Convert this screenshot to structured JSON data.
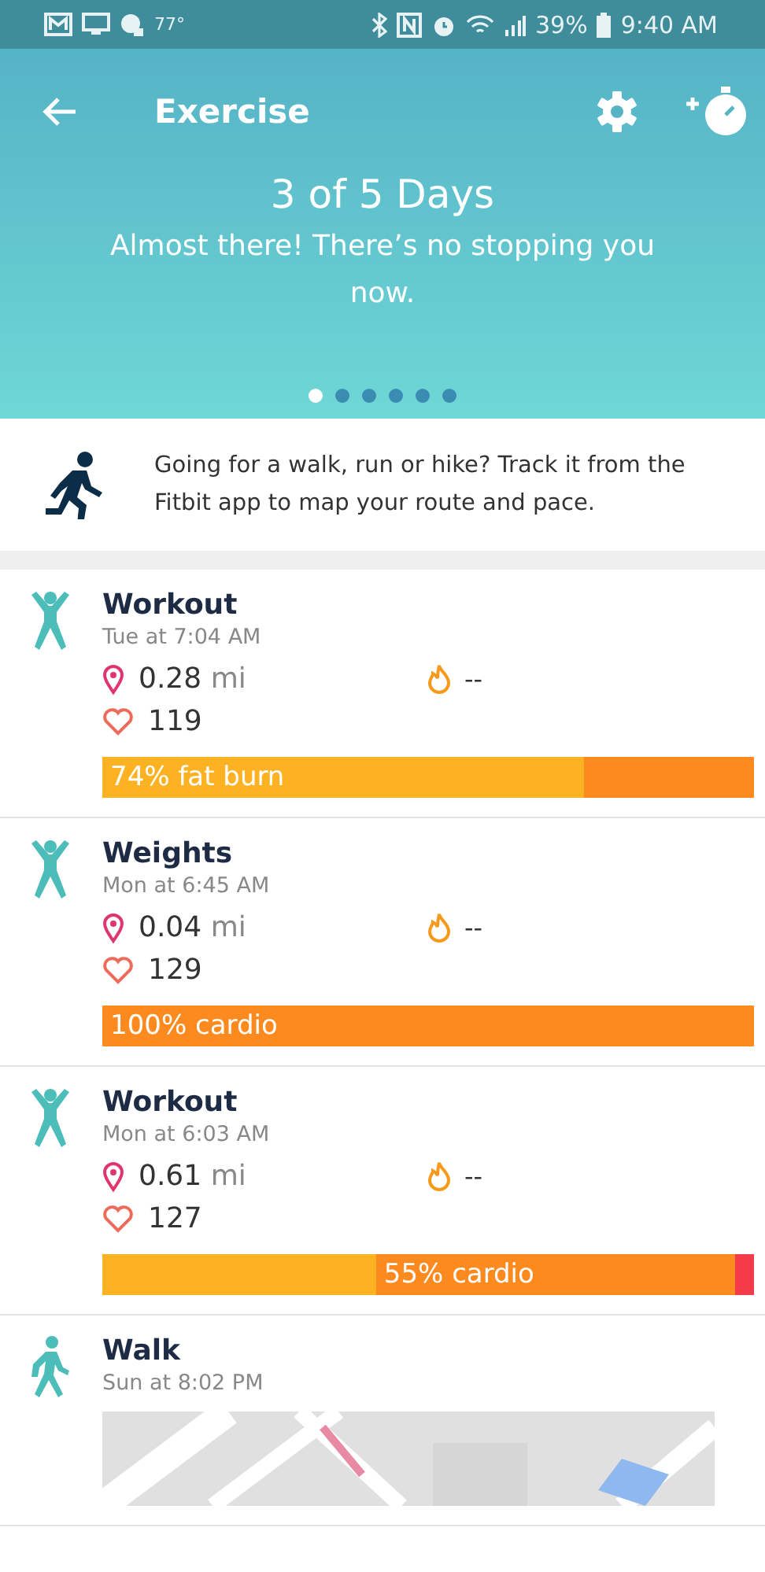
{
  "status_bar": {
    "temperature": "77°",
    "battery": "39%",
    "time": "9:40 AM"
  },
  "toolbar": {
    "title": "Exercise"
  },
  "goal": {
    "title": "3 of 5 Days",
    "message": "Almost there! There’s no stopping you now.",
    "dots": [
      {
        "selected": true
      },
      {
        "selected": false
      },
      {
        "selected": false
      },
      {
        "selected": false
      },
      {
        "selected": false
      },
      {
        "selected": false
      }
    ]
  },
  "tip": {
    "text": "Going for a walk, run or hike? Track it from the Fitbit app to map your route and pace."
  },
  "activities": [
    {
      "kind": "workout",
      "title": "Workout",
      "time": "Tue at 7:04 AM",
      "distance": "0.28",
      "unit": "mi",
      "calories": "--",
      "heart_rate": "119",
      "zones": [
        {
          "kind": "fat_burn",
          "level": 0.74,
          "label": "74% fat burn"
        },
        {
          "kind": "cardio"
        }
      ]
    },
    {
      "kind": "workout",
      "title": "Weights",
      "time": "Mon at 6:45 AM",
      "distance": "0.04",
      "unit": "mi",
      "calories": "--",
      "heart_rate": "129",
      "zones": [
        {
          "kind": "cardio",
          "label": "100% cardio"
        }
      ]
    },
    {
      "kind": "workout",
      "title": "Workout",
      "time": "Mon at 6:03 AM",
      "distance": "0.61",
      "unit": "mi",
      "calories": "--",
      "heart_rate": "127",
      "zones": [
        {
          "kind": "fat_burn",
          "level": 0.42
        },
        {
          "kind": "cardio",
          "level": 0.97,
          "label": "55% cardio"
        },
        {
          "kind": "peak"
        }
      ]
    },
    {
      "kind": "walk",
      "title": "Walk",
      "time": "Sun at 8:02 PM"
    }
  ]
}
